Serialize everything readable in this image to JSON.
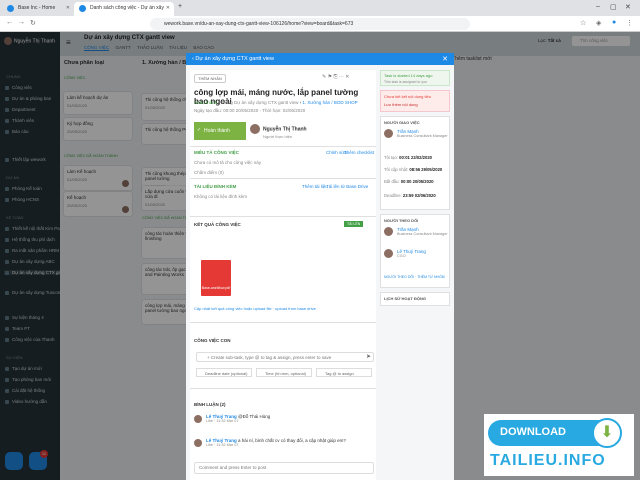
{
  "browser": {
    "tabs": [
      {
        "label": "Base Inc - Home"
      },
      {
        "label": "Danh sách công việc - Dự án xây"
      }
    ],
    "url": "wework.base.vn/du-an-xay-dung-ctx-gantt-view-106126/home?view=board&task=673"
  },
  "sidebar": {
    "user": "Nguyễn Thị Thanh",
    "sections": [
      {
        "label": "Chung"
      },
      {
        "label": "Dự án"
      },
      {
        "label": "Kế toán"
      },
      {
        "label": "Sự kiện"
      }
    ],
    "items": [
      {
        "label": "Công việc"
      },
      {
        "label": "Dự án & phòng ban"
      },
      {
        "label": "Department"
      },
      {
        "label": "Thành viên"
      },
      {
        "label": "Báo cáo"
      },
      {
        "label": "Thiết lập wework"
      },
      {
        "label": "Phòng Kế toán"
      },
      {
        "label": "Phòng HCNS"
      },
      {
        "label": "Thiết kế nội thất Kim Pal"
      },
      {
        "label": "Hệ thống thu phí dịch"
      },
      {
        "label": "Ra mắt sản phẩm HRM"
      },
      {
        "label": "Dự án xây dựng ABC"
      },
      {
        "label": "Dự án xây dựng CTX gantt"
      },
      {
        "label": "Dự án xây dựng Tuscon Land"
      },
      {
        "label": "Sự kiện tháng 4"
      },
      {
        "label": "Team PT"
      },
      {
        "label": "Công việc của Thanh"
      },
      {
        "label": "Tạo dự án mới"
      },
      {
        "label": "Tạo phòng ban mới"
      },
      {
        "label": "Cài đặt hệ thống"
      },
      {
        "label": "Video hướng dẫn"
      }
    ],
    "notif_count": "11"
  },
  "board": {
    "title": "Dự án xây dựng CTX gantt view",
    "tabs": [
      "CÔNG VIỆC",
      "GANTT",
      "THẢO LUẬN",
      "TÀI LIỆU",
      "BÁO CÁO"
    ],
    "filter_label": "Tất cả",
    "search_placeholder": "Tìm công việc",
    "add_list": "+ Thêm tasklist mới",
    "columns": [
      {
        "title": "Chưa phân loại",
        "groups": [
          {
            "label": "CÔNG VIỆC",
            "cards": [
              {
                "title": "Làm kế hoạch dự án",
                "date": "01/05/2020"
              },
              {
                "title": "Ký hợp đồng",
                "date": "20/05/2020"
              }
            ]
          },
          {
            "label": "CÔNG VIỆC ĐÃ HOÀN THÀNH",
            "cards": [
              {
                "title": "Làm Kế hoạch",
                "date": "01/05/2020"
              },
              {
                "title": "Kế hoạch",
                "date": "20/05/2020"
              }
            ]
          }
        ]
      },
      {
        "title": "1. Xưởng hàn / BOD",
        "groups": [
          {
            "label": "",
            "cards": [
              {
                "title": "Thi công hệ thống chống sét",
                "date": "01/05/2020"
              },
              {
                "title": "Thi công hệ thống PCCC",
                "date": ""
              },
              {
                "title": "Thi công khung thép và tấm panel tường",
                "date": "01/05/2020"
              },
              {
                "title": "Lắp dựng cửa cuốn và các cửa đi",
                "date": "01/05/2020"
              }
            ]
          },
          {
            "label": "CÔNG VIỆC ĐÃ HOÀN THÀNH",
            "cards": [
              {
                "title": "công tác hoàn thiện và finishing",
                "date": ""
              },
              {
                "title": "công tác trát, ốp gạch Brick and Painting Works",
                "date": ""
              },
              {
                "title": "công lợp mái, máng nước panel tường bao ngoài",
                "date": ""
              }
            ]
          }
        ]
      }
    ]
  },
  "modal": {
    "header": "Dự án xây dựng CTX gantt view",
    "chip_label": "THÊM NHÃN",
    "title": "công lợp mái, máng nước, lắp panel tường bao ngoài",
    "status": "Hoàn thành",
    "breadcrumb_project": "Trong Dự án xây dựng CTX gantt view",
    "breadcrumb_list": "1. Xưởng hàn / BOD SHOP",
    "created": "Ngày tạo đầu: 00:00 20/05/2020",
    "done_at": "Thời hạn: 02/06/2020",
    "done_button": "Hoàn thành",
    "assignee_name": "Nguyễn Thị Thanh",
    "assignee_role": "Người thực hiện",
    "desc_title": "MIÊU TẢ CÔNG VIỆC",
    "desc_edit": "Chỉnh sửa",
    "desc_checklist": "Thêm checklist",
    "desc_empty": "Chưa có mô tả cho công việc này",
    "rating": "Chấm điểm (0)",
    "attach_title": "TÀI LIỆU ĐÍNH KÈM",
    "attach_add": "Thêm tài liệu",
    "attach_base": "Tải lên từ Base Drive",
    "attach_empty": "Không có tài liệu đính kèm",
    "result_title": "KẾT QUẢ CÔNG VIỆC",
    "result_badge": "TẢI LÊN",
    "pdf_name": "Base-workflow.pdf",
    "result_links": "Cập nhật kết quả công việc hoặc upload file · upload from base drive",
    "sub_title": "CÔNG VIỆC CON",
    "sub_input": "+ Create sub-task, type @ to tag & assign, press enter to save",
    "sub_deadline": "Deadline date (optional)",
    "sub_time": "Time (hh:mm, optional)",
    "sub_tag": "Tag @ to assign",
    "comment_title": "BÌNH LUẬN (2)",
    "comments": [
      {
        "author": "Lê Thuý Trang",
        "text": "@Đỗ Thái Hùng",
        "meta": "Like · 11:32 Mar 07"
      },
      {
        "author": "Lê Thuý Trang",
        "text": "a hài ní, bình chất cv có thay đổi, a cập nhật giúp em?",
        "meta": "Like · 11:32 Mar 07"
      }
    ],
    "comment_input": "Comment and press Enter to post"
  },
  "side": {
    "started_note": "Task is started 14 days ago",
    "started_sub": "This task is assigned to you",
    "overdue_note": "Chưa kết kết nội dung tiêu",
    "overdue_link": "Lưu thêm nội dung",
    "creator_title": "NGƯỜI GIAO VIỆC",
    "creator_name": "Trần Mạnh",
    "creator_role": "Business Consultant Manager",
    "dates": [
      {
        "label": "Tôi tạo:",
        "value": "00:01 22/02/2020"
      },
      {
        "label": "Tôi cập nhật:",
        "value": "08:56 29/05/2020"
      },
      {
        "label": "Bắt đầu:",
        "value": "00:00 20/05/2020"
      },
      {
        "label": "Deadline:",
        "value": "23:59 02/06/2020"
      }
    ],
    "followers_title": "NGƯỜI THEO DÕI",
    "followers": [
      {
        "name": "Trần Mạnh",
        "role": "Business Consultant Manager"
      },
      {
        "name": "Lê Thuý Trang",
        "role": "CGO"
      }
    ],
    "follow_actions": "NGƯỜI THEO DÕI · THÊM TỪ NHÓM",
    "history_title": "LỊCH SỬ HOẠT ĐỘNG"
  },
  "watermark": {
    "download": "DOWNLOAD",
    "site": "TAILIEU.INFO"
  }
}
